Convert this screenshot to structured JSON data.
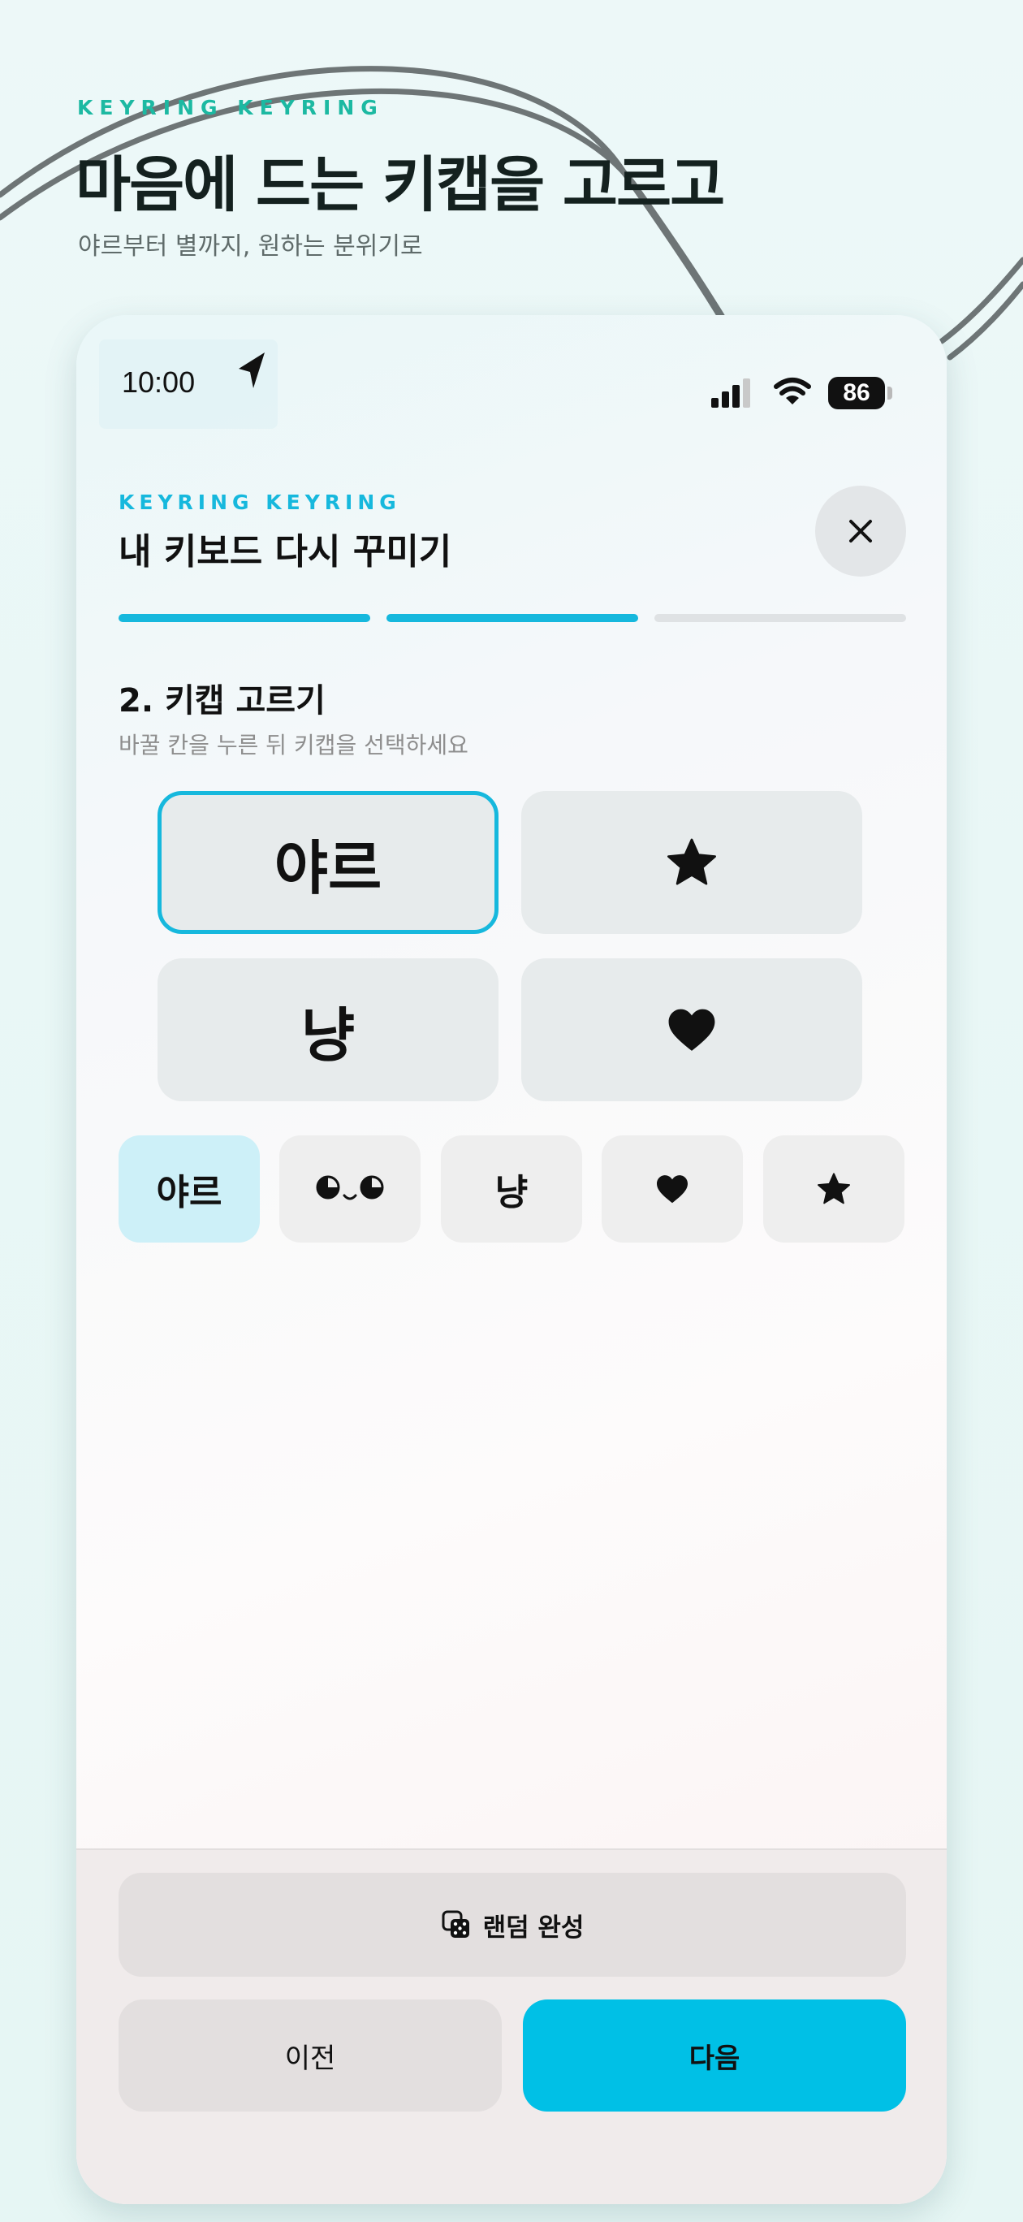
{
  "promo": {
    "brand": "KEYRING KEYRING",
    "title": "마음에 드는 키캡을 고르고",
    "subtitle": "야르부터 별까지, 원하는 분위기로"
  },
  "status_bar": {
    "time": "10:00",
    "battery": "86",
    "icons": [
      "location-arrow-icon",
      "cellular-signal-icon",
      "wifi-icon",
      "battery-icon"
    ]
  },
  "header": {
    "brand": "KEYRING KEYRING",
    "title": "내 키보드 다시 꾸미기",
    "close_icon": "close-icon"
  },
  "progress": {
    "steps_total": 3,
    "steps_done": 2
  },
  "step": {
    "title": "2. 키캡 고르기",
    "hint": "바꿀 칸을 누른 뒤 키캡을 선택하세요"
  },
  "keycaps": [
    {
      "label": "야르",
      "selected": true
    },
    {
      "icon": "star-icon",
      "selected": false
    },
    {
      "label": "냥",
      "selected": false
    },
    {
      "icon": "heart-icon",
      "selected": false
    }
  ],
  "options": [
    {
      "label": "야르",
      "active": true
    },
    {
      "icon": "kaomoji-face-icon",
      "active": false
    },
    {
      "label": "냥",
      "active": false
    },
    {
      "icon": "heart-icon",
      "active": false
    },
    {
      "icon": "star-icon",
      "active": false
    }
  ],
  "actions": {
    "random_label": "랜덤 완성",
    "random_icon": "dice-icon",
    "prev_label": "이전",
    "next_label": "다음"
  },
  "colors": {
    "accent": "#16b8dd",
    "next_button": "#00c0e6",
    "promo_brand": "#1cb9a2",
    "active_chip": "#cdf0f8"
  }
}
